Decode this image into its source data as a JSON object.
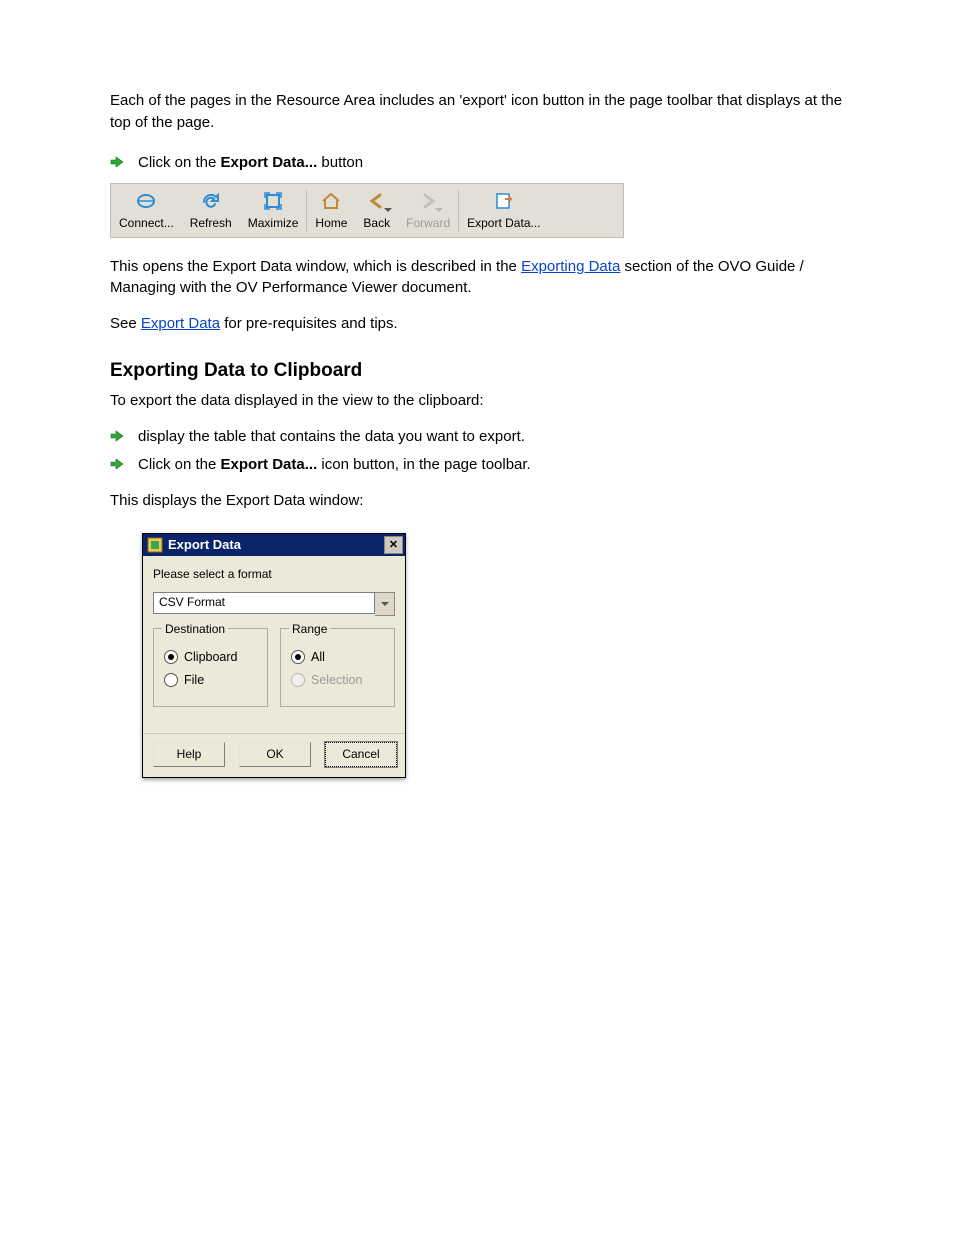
{
  "text": {
    "intro1": "Each of the pages in the Resource Area includes an 'export' icon button in the page toolbar that displays at the top of the page.",
    "bullet_lead": "Click on the",
    "bullet_bold": "Export Data...",
    "bullet_trail": "button",
    "para_after_toolbar": "This opens the Export Data window, which is described in the ",
    "link1_text": "Exporting Data",
    "link1_trail": " section of the OVO Guide / Managing with the OV Performance Viewer document.",
    "para_see": "See ",
    "link2_text": "Export Data",
    "link2_trail": " for pre-requisites and tips.",
    "h1": "Exporting Data to Clipboard",
    "h1_desc": "To export the data displayed in the view to the clipboard:",
    "step1": "display the table that contains the data you want to export.",
    "step2_lead": "Click on the ",
    "step2_bold": "Export Data...",
    "step2_trail": " icon button, in the page toolbar.",
    "step3": "This displays the Export Data window:"
  },
  "toolbar": [
    {
      "label": "Connect...",
      "icon": "connect",
      "disabled": false
    },
    {
      "label": "Refresh",
      "icon": "refresh",
      "disabled": false
    },
    {
      "label": "Maximize",
      "icon": "maximize",
      "disabled": false
    },
    {
      "label": "Home",
      "icon": "home",
      "disabled": false,
      "sep_before": true
    },
    {
      "label": "Back",
      "icon": "back",
      "disabled": false,
      "dropdown": true
    },
    {
      "label": "Forward",
      "icon": "forward",
      "disabled": true,
      "dropdown": true
    },
    {
      "label": "Export Data...",
      "icon": "export",
      "disabled": false,
      "sep_before": true
    }
  ],
  "dialog": {
    "title": "Export Data",
    "prompt": "Please select a format",
    "format": "CSV Format",
    "groups": {
      "destination": {
        "legend": "Destination",
        "options": [
          {
            "label": "Clipboard",
            "selected": true,
            "disabled": false
          },
          {
            "label": "File",
            "selected": false,
            "disabled": false
          }
        ]
      },
      "range": {
        "legend": "Range",
        "options": [
          {
            "label": "All",
            "selected": true,
            "disabled": false
          },
          {
            "label": "Selection",
            "selected": false,
            "disabled": true
          }
        ]
      }
    },
    "buttons": {
      "help": "Help",
      "ok": "OK",
      "cancel": "Cancel"
    }
  }
}
